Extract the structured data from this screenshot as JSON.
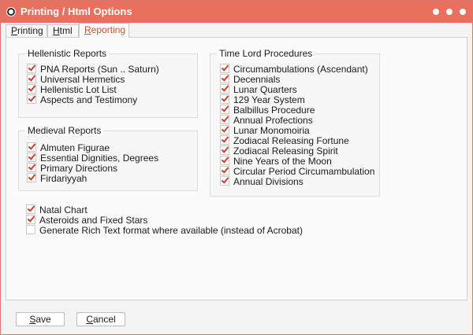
{
  "window": {
    "title": "Printing / Html Options"
  },
  "tabs": [
    {
      "label": "Printing",
      "underline": "P",
      "rest": "rinting"
    },
    {
      "label": "Html",
      "underline": "H",
      "rest": "tml"
    },
    {
      "label": "Reporting",
      "underline": "R",
      "rest": "eporting"
    }
  ],
  "hellenistic": {
    "title": "Hellenistic Reports",
    "items": [
      "PNA Reports (Sun .. Saturn)",
      "Universal Hermetics",
      "Hellenistic Lot List",
      "Aspects and Testimony"
    ]
  },
  "medieval": {
    "title": "Medieval Reports",
    "items": [
      "Almuten Figurae",
      "Essential Dignities, Degrees",
      "Primary Directions",
      "Firdariyyah"
    ]
  },
  "timelord": {
    "title": "Time Lord Procedures",
    "items": [
      "Circumambulations (Ascendant)",
      "Decennials",
      "Lunar Quarters",
      "129 Year System",
      "Balbillus Procedure",
      "Annual Profections",
      "Lunar Monomoiria",
      "Zodiacal Releasing Fortune",
      "Zodiacal Releasing Spirit",
      "Nine Years of the Moon",
      "Circular Period Circumambulation",
      "Annual Divisions"
    ]
  },
  "extra": {
    "natal": "Natal Chart",
    "asteroids": "Asteroids and Fixed Stars",
    "rtf": "Generate Rich Text format where available (instead of Acrobat)"
  },
  "buttons": {
    "save": {
      "underline": "S",
      "rest": "ave"
    },
    "cancel": {
      "underline": "C",
      "rest": "ancel"
    }
  }
}
